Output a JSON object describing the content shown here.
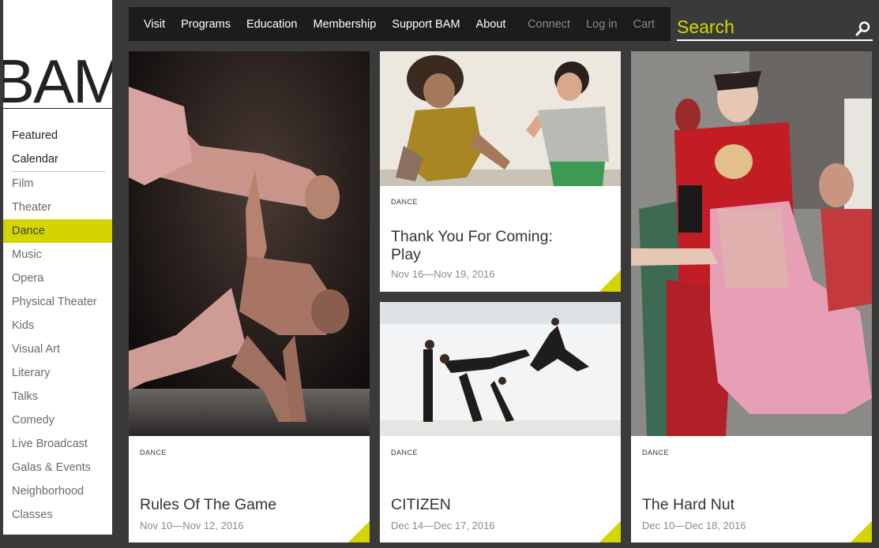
{
  "brand": {
    "logo_text": "BAM"
  },
  "sidebar": {
    "primary": [
      {
        "label": "Featured"
      },
      {
        "label": "Calendar"
      }
    ],
    "categories": [
      {
        "label": "Film"
      },
      {
        "label": "Theater"
      },
      {
        "label": "Dance",
        "active": true
      },
      {
        "label": "Music"
      },
      {
        "label": "Opera"
      },
      {
        "label": "Physical Theater"
      },
      {
        "label": "Kids"
      },
      {
        "label": "Visual Art"
      },
      {
        "label": "Literary"
      },
      {
        "label": "Talks"
      },
      {
        "label": "Comedy"
      },
      {
        "label": "Live Broadcast"
      },
      {
        "label": "Galas & Events"
      },
      {
        "label": "Neighborhood"
      },
      {
        "label": "Classes"
      }
    ]
  },
  "topnav": {
    "links": [
      "Visit",
      "Programs",
      "Education",
      "Membership",
      "Support BAM",
      "About"
    ],
    "utility": [
      "Connect",
      "Log in",
      "Cart"
    ]
  },
  "search": {
    "placeholder": "Search"
  },
  "cards": [
    {
      "category": "DANCE",
      "title": "Rules Of The Game",
      "dates": "Nov 10—Nov 12, 2016"
    },
    {
      "category": "DANCE",
      "title": "Thank You For Coming:",
      "title_line2": "Play",
      "dates": "Nov 16—Nov 19, 2016"
    },
    {
      "category": "DANCE",
      "title": "CITIZEN",
      "dates": "Dec 14—Dec 17, 2016"
    },
    {
      "category": "DANCE",
      "title": "The Hard Nut",
      "dates": "Dec 10—Dec 18, 2016"
    }
  ],
  "colors": {
    "accent": "#d4d400",
    "page_bg": "#3a3a3a",
    "topbar_bg": "#1c1c1c"
  }
}
